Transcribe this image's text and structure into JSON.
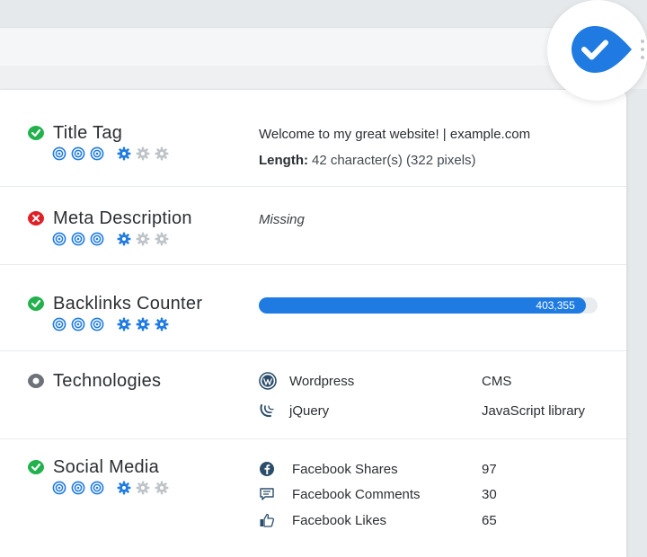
{
  "colors": {
    "accent": "#1f7be1",
    "ok": "#22b14c",
    "error": "#e02027",
    "neutral": "#6d7278",
    "muted_icon": "#bfc4c9"
  },
  "header": {
    "badge_icon": "checkmark-badge-icon",
    "menu_icon": "kebab-menu-icon"
  },
  "rows": {
    "title_tag": {
      "title": "Title Tag",
      "status": "ok",
      "rating": {
        "importance": 3,
        "difficulty": 1,
        "difficulty_max": 3
      },
      "value": "Welcome to my great website! | example.com",
      "length_label": "Length:",
      "length_value": "42 character(s) (322 pixels)"
    },
    "meta_description": {
      "title": "Meta Description",
      "status": "error",
      "rating": {
        "importance": 3,
        "difficulty": 1,
        "difficulty_max": 3
      },
      "value": "Missing"
    },
    "backlinks_counter": {
      "title": "Backlinks Counter",
      "status": "ok",
      "rating": {
        "importance": 3,
        "difficulty": 3,
        "difficulty_max": 3
      },
      "value": "403,355",
      "progress_fraction": 0.965
    },
    "technologies": {
      "title": "Technologies",
      "status": "info",
      "items": [
        {
          "name": "Wordpress",
          "category": "CMS",
          "icon": "wordpress-icon"
        },
        {
          "name": "jQuery",
          "category": "JavaScript library",
          "icon": "jquery-icon"
        }
      ]
    },
    "social_media": {
      "title": "Social Media",
      "status": "ok",
      "rating": {
        "importance": 3,
        "difficulty": 1,
        "difficulty_max": 3
      },
      "items": [
        {
          "name": "Facebook Shares",
          "value": "97",
          "icon": "facebook-icon"
        },
        {
          "name": "Facebook Comments",
          "value": "30",
          "icon": "comment-icon"
        },
        {
          "name": "Facebook Likes",
          "value": "65",
          "icon": "thumbs-up-icon"
        }
      ]
    }
  }
}
